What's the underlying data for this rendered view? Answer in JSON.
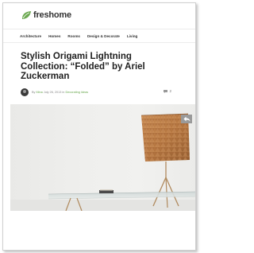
{
  "site": {
    "brand": "freshome"
  },
  "nav": {
    "items": [
      {
        "label": "Architecture"
      },
      {
        "label": "Homes"
      },
      {
        "label": "Rooms"
      },
      {
        "label": "Design & Decorate"
      },
      {
        "label": "Living"
      }
    ]
  },
  "article": {
    "title": "Stylish Origami Lightning Collection: “Folded” by Ariel Zuckerman",
    "meta_prefix": "By ",
    "author": "Mina",
    "date": "July 26, 2013",
    "meta_in": " in ",
    "category": "Decorating Ideas",
    "comment_count": "2"
  },
  "icons": {
    "logo": "leaf-logo-icon",
    "comment": "comment-icon",
    "share": "share-arrow-icon"
  },
  "colors": {
    "brand_green": "#6aa84f",
    "share_bg": "#9a9a9a"
  }
}
